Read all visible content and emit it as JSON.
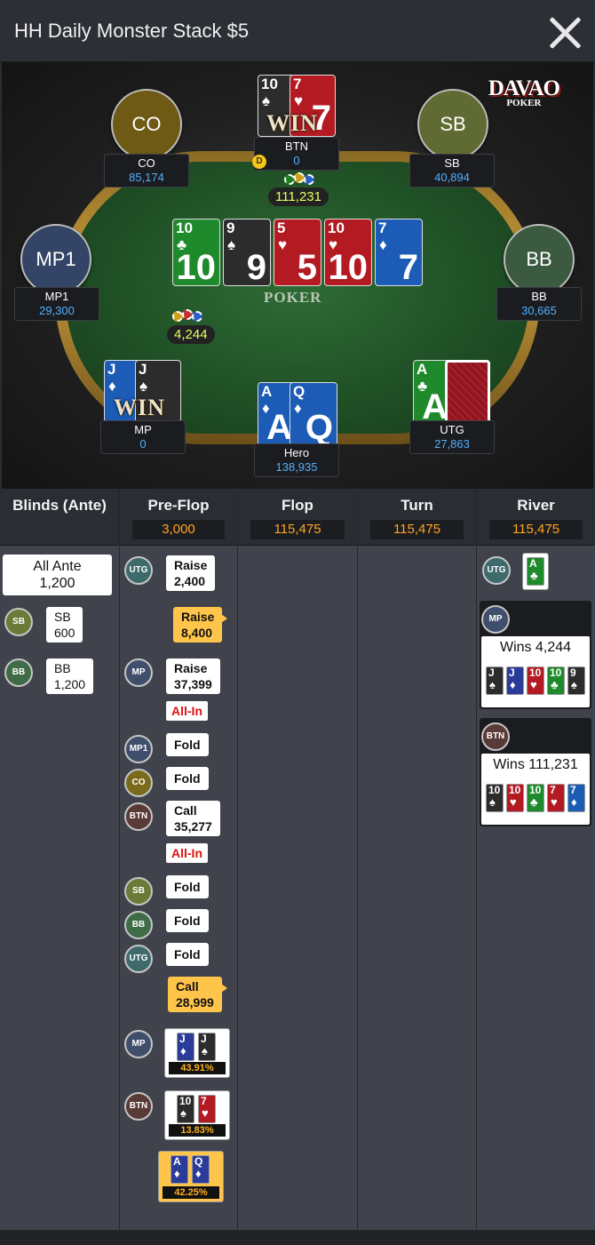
{
  "header": {
    "title": "HH Daily Monster Stack $5"
  },
  "brand": {
    "name": "DAVAO",
    "sub": "POKER"
  },
  "felt_logo": "POKER",
  "seats": {
    "co": {
      "label": "CO",
      "name": "CO",
      "stack": "85,174",
      "color": "#6e5a14"
    },
    "btn": {
      "name": "BTN",
      "stack": "0"
    },
    "sb": {
      "label": "SB",
      "name": "SB",
      "stack": "40,894",
      "color": "#5f6b33"
    },
    "mp1": {
      "label": "MP1",
      "name": "MP1",
      "stack": "29,300",
      "color": "#334466"
    },
    "bb": {
      "label": "BB",
      "name": "BB",
      "stack": "30,665",
      "color": "#3b5a40"
    },
    "mp": {
      "name": "MP",
      "stack": "0"
    },
    "hero": {
      "name": "Hero",
      "stack": "138,935"
    },
    "utg": {
      "name": "UTG",
      "stack": "27,863"
    }
  },
  "dealer_label": "D",
  "win_label": "WIN",
  "pots": {
    "main": "111,231",
    "side": "4,244"
  },
  "hole_cards": {
    "btn": [
      {
        "rank": "10",
        "suit": "♠"
      },
      {
        "rank": "7",
        "suit": "♥"
      }
    ],
    "mp": [
      {
        "rank": "J",
        "suit": "♦"
      },
      {
        "rank": "J",
        "suit": "♠"
      }
    ],
    "hero": [
      {
        "rank": "A",
        "suit": "♦"
      },
      {
        "rank": "Q",
        "suit": "♦"
      }
    ],
    "utg": [
      {
        "rank": "A",
        "suit": "♣"
      }
    ]
  },
  "board": [
    {
      "rank": "10",
      "suit": "♣",
      "color": "green"
    },
    {
      "rank": "9",
      "suit": "♠",
      "color": "black"
    },
    {
      "rank": "5",
      "suit": "♥",
      "color": "red"
    },
    {
      "rank": "10",
      "suit": "♥",
      "color": "red"
    },
    {
      "rank": "7",
      "suit": "♦",
      "color": "blue"
    }
  ],
  "columns": [
    {
      "name": "Blinds (Ante)",
      "pot": ""
    },
    {
      "name": "Pre-Flop",
      "pot": "3,000"
    },
    {
      "name": "Flop",
      "pot": "115,475"
    },
    {
      "name": "Turn",
      "pot": "115,475"
    },
    {
      "name": "River",
      "pot": "115,475"
    }
  ],
  "blinds": {
    "ante_label": "All Ante",
    "ante_value": "1,200",
    "sb": {
      "pos": "SB",
      "label": "SB",
      "value": "600"
    },
    "bb": {
      "pos": "BB",
      "label": "BB",
      "value": "1,200"
    }
  },
  "preflop": [
    {
      "pos": "UTG",
      "action": "Raise",
      "amount": "2,400"
    },
    {
      "pos": "",
      "action": "Raise",
      "amount": "8,400",
      "hero": true
    },
    {
      "pos": "MP",
      "action": "Raise",
      "amount": "37,399",
      "allin": "All-In"
    },
    {
      "pos": "MP1",
      "action": "Fold"
    },
    {
      "pos": "CO",
      "action": "Fold"
    },
    {
      "pos": "BTN",
      "action": "Call",
      "amount": "35,277",
      "allin": "All-In"
    },
    {
      "pos": "SB",
      "action": "Fold"
    },
    {
      "pos": "BB",
      "action": "Fold"
    },
    {
      "pos": "UTG",
      "action": "Fold"
    },
    {
      "pos": "",
      "action": "Call",
      "amount": "28,999",
      "hero": true
    }
  ],
  "showdown": [
    {
      "pos": "MP",
      "equity": "43.91%"
    },
    {
      "pos": "BTN",
      "equity": "13.83%"
    },
    {
      "pos": "",
      "equity": "42.25%",
      "hero": true
    }
  ],
  "river": {
    "utg_pos": "UTG",
    "winners": [
      {
        "pos": "MP",
        "text": "Wins 4,244"
      },
      {
        "pos": "BTN",
        "text": "Wins 111,231"
      }
    ]
  },
  "colors": {
    "pot_text": "#ffa423",
    "stack_text": "#4fb0ff",
    "hero_bubble": "#ffc44a",
    "allin_text": "#dd1111"
  }
}
